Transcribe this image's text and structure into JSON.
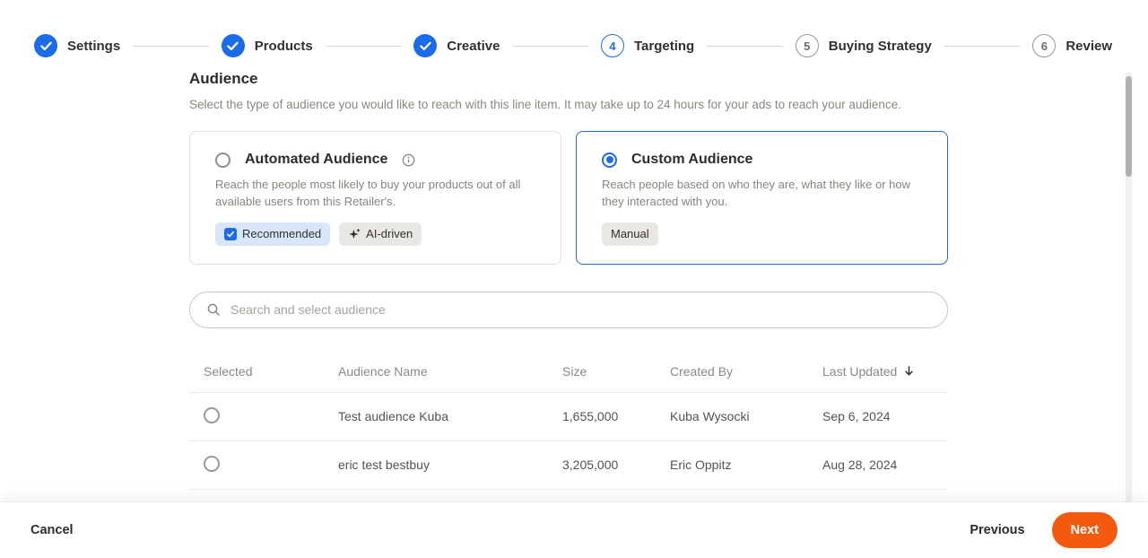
{
  "colors": {
    "accent_blue": "#1b6ce9",
    "next_orange": "#f45a0d"
  },
  "stepper": {
    "steps": [
      {
        "label": "Settings",
        "state": "completed"
      },
      {
        "label": "Products",
        "state": "completed"
      },
      {
        "label": "Creative",
        "state": "completed"
      },
      {
        "label": "Targeting",
        "state": "current",
        "number": "4"
      },
      {
        "label": "Buying Strategy",
        "state": "upcoming",
        "number": "5"
      },
      {
        "label": "Review",
        "state": "upcoming",
        "number": "6"
      }
    ]
  },
  "audience": {
    "title": "Audience",
    "subtitle": "Select the type of audience you would like to reach with this line item. It may take up to 24 hours for your ads to reach your audience.",
    "options": [
      {
        "title": "Automated Audience",
        "description": "Reach the people most likely to buy your products out of all available users from this Retailer's.",
        "badges": [
          "Recommended",
          "AI-driven"
        ],
        "selected": false
      },
      {
        "title": "Custom Audience",
        "description": "Reach people based on who they are, what they like or how they interacted with you.",
        "badges": [
          "Manual"
        ],
        "selected": true
      }
    ],
    "search_placeholder": "Search and select audience",
    "table": {
      "headers": [
        "Selected",
        "Audience Name",
        "Size",
        "Created By",
        "Last Updated"
      ],
      "sort": {
        "column": "Last Updated",
        "direction": "desc"
      },
      "rows": [
        {
          "name": "Test audience Kuba",
          "size": "1,655,000",
          "created_by": "Kuba Wysocki",
          "last_updated": "Sep 6, 2024",
          "selected": false
        },
        {
          "name": "eric test bestbuy",
          "size": "3,205,000",
          "created_by": "Eric Oppitz",
          "last_updated": "Aug 28, 2024",
          "selected": false
        }
      ]
    }
  },
  "footer": {
    "cancel_label": "Cancel",
    "previous_label": "Previous",
    "next_label": "Next"
  },
  "icons": {
    "check": "checkmark in completed step circle",
    "info": "circled i",
    "recommended": "blue rounded square with white check",
    "ai_sparkle": "four-point star with plus",
    "search": "magnifier",
    "sort_desc": "downward arrow"
  }
}
